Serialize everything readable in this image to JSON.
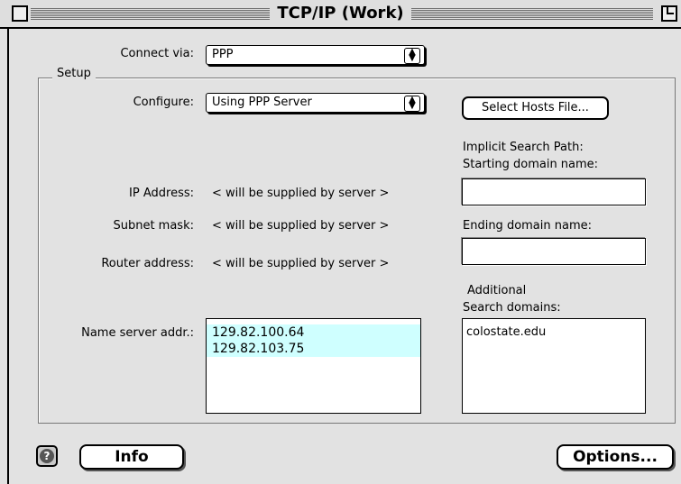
{
  "window": {
    "title": "TCP/IP (Work)"
  },
  "connect": {
    "label": "Connect via:",
    "value": "PPP"
  },
  "setup": {
    "title": "Setup",
    "configure_label": "Configure:",
    "configure_value": "Using PPP Server",
    "select_hosts_label": "Select Hosts File...",
    "ip_label": "IP Address:",
    "ip_value": "< will be supplied by server >",
    "subnet_label": "Subnet mask:",
    "subnet_value": "< will be supplied by server >",
    "router_label": "Router address:",
    "router_value": "< will be supplied by server >",
    "name_server_label": "Name server addr.:",
    "name_servers": [
      "129.82.100.64",
      "129.82.103.75"
    ],
    "implicit_search_label_1": "Implicit Search Path:",
    "implicit_search_label_2": "Starting domain name:",
    "starting_domain_value": "",
    "ending_domain_label": "Ending domain name:",
    "ending_domain_value": "",
    "additional_label_1": "Additional",
    "additional_label_2": "Search domains:",
    "search_domains": [
      "colostate.edu"
    ]
  },
  "footer": {
    "help_icon": "?",
    "info_label": "Info",
    "options_label": "Options..."
  }
}
